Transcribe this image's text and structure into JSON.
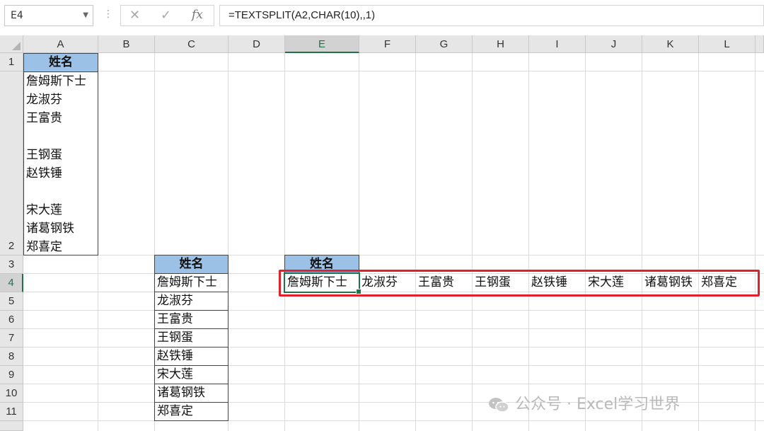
{
  "name_box": {
    "value": "E4"
  },
  "formula_bar": {
    "cancel_glyph": "✕",
    "enter_glyph": "✓",
    "fx_label": "fx",
    "formula": "=TEXTSPLIT(A2,CHAR(10),,1)"
  },
  "columns": [
    "A",
    "B",
    "C",
    "D",
    "E",
    "F",
    "G",
    "H",
    "I",
    "J",
    "K",
    "L"
  ],
  "rows": [
    "1",
    "2",
    "3",
    "4",
    "5",
    "6",
    "7",
    "8",
    "9",
    "10",
    "11"
  ],
  "active": {
    "column": "E",
    "row": "4"
  },
  "cells": {
    "A1": "姓名",
    "A2_lines": [
      "詹姆斯下士",
      "龙淑芬",
      "王富贵",
      "",
      "王钢蛋",
      "赵铁锤",
      "",
      "宋大莲",
      "诸葛钢铁",
      "郑喜定"
    ],
    "C3": "姓名",
    "C_list": [
      "詹姆斯下士",
      "龙淑芬",
      "王富贵",
      "王钢蛋",
      "赵铁锤",
      "宋大莲",
      "诸葛钢铁",
      "郑喜定"
    ],
    "E3": "姓名",
    "row4_spill": [
      "詹姆斯下士",
      "龙淑芬",
      "王富贵",
      "王钢蛋",
      "赵铁锤",
      "宋大莲",
      "诸葛钢铁",
      "郑喜定"
    ]
  },
  "colors": {
    "header_fill": "#9bc2e6",
    "selection": "#217346",
    "highlight": "#e0202a"
  },
  "watermark": {
    "text": "公众号 · Excel学习世界"
  }
}
